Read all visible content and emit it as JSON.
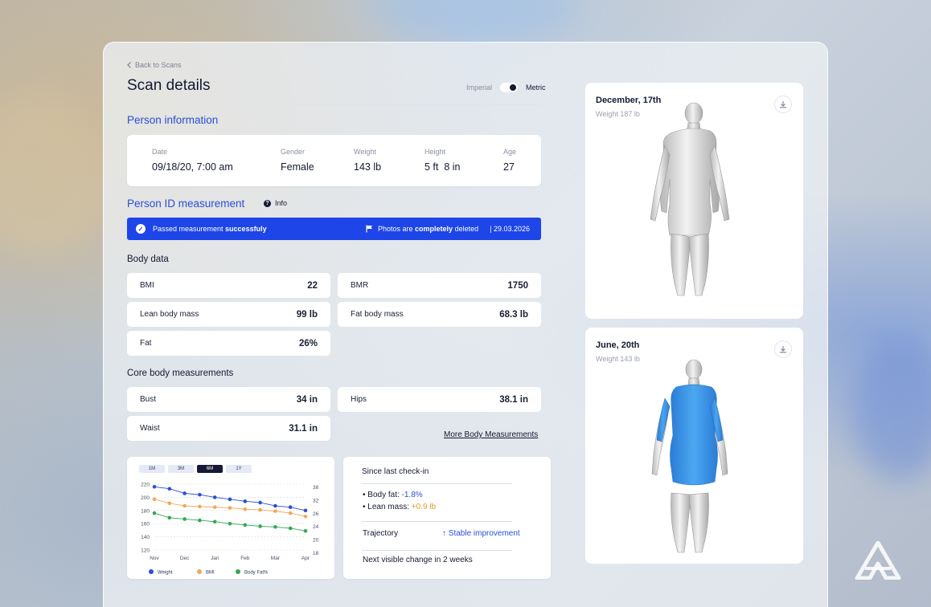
{
  "nav": {
    "back_label": "Back to Scans"
  },
  "page_title": "Scan details",
  "units": {
    "imperial": "Imperial",
    "metric": "Metric",
    "selected": "Metric"
  },
  "person_info": {
    "heading": "Person information",
    "date_label": "Date",
    "date_value": "09/18/20, 7:00 am",
    "gender_label": "Gender",
    "gender_value": "Female",
    "weight_label": "Weight",
    "weight_value": "143 lb",
    "height_label": "Height",
    "height_value": "5 ft  8 in",
    "age_label": "Age",
    "age_value": "27"
  },
  "id_measurement": {
    "heading": "Person ID measurement",
    "info_label": "Info",
    "status_prefix": "Passed measurement ",
    "status_strong": "successfuly",
    "photos_prefix": "Photos are ",
    "photos_strong": "completely",
    "photos_suffix": " deleted",
    "date": "| 29.03.2026"
  },
  "body_data": {
    "heading": "Body data",
    "items": [
      {
        "label": "BMI",
        "value": "22"
      },
      {
        "label": "BMR",
        "value": "1750"
      },
      {
        "label": "Lean body mass",
        "value": "99 lb"
      },
      {
        "label": "Fat body mass",
        "value": "68.3 lb"
      },
      {
        "label": "Fat",
        "value": "26%"
      }
    ]
  },
  "core_measurements": {
    "heading": "Core body measurements",
    "items": [
      {
        "label": "Bust",
        "value": "34 in"
      },
      {
        "label": "Hips",
        "value": "38.1 in"
      },
      {
        "label": "Waist",
        "value": "31.1 in"
      }
    ],
    "more_link": "More Body Measurements"
  },
  "chart": {
    "periods": [
      "1M",
      "3M",
      "6M",
      "1Y"
    ],
    "active_period": "6M"
  },
  "chart_data": {
    "type": "line",
    "x": [
      "Nov",
      "Dec",
      "Jan",
      "Feb",
      "Mar",
      "Apr"
    ],
    "x_points": [
      0,
      0.5,
      1,
      1.5,
      2,
      2.5,
      3,
      3.5,
      4,
      4.5,
      5
    ],
    "left_axis": {
      "ticks": [
        220,
        200,
        180,
        160,
        140,
        120
      ],
      "ylim": [
        120,
        220
      ]
    },
    "right_axis": {
      "ticks": [
        38,
        32,
        26,
        24,
        20,
        18
      ]
    },
    "grid": true,
    "legend_position": "bottom",
    "series": [
      {
        "name": "Weight",
        "color": "#2a4fd6",
        "values": [
          216,
          213,
          206,
          204,
          200,
          197,
          194,
          192,
          187,
          185,
          180
        ]
      },
      {
        "name": "BMI",
        "color": "#f0a95a",
        "values": [
          197,
          191,
          187,
          186,
          185,
          184,
          182,
          181,
          179,
          176,
          171
        ]
      },
      {
        "name": "Body Fat%",
        "color": "#34a853",
        "values": [
          176,
          169,
          167,
          165,
          163,
          160,
          158,
          156,
          155,
          153,
          149
        ]
      }
    ]
  },
  "checkin": {
    "title": "Since last check-in",
    "fat_label": "Body fat: ",
    "fat_value": "-1.8%",
    "lean_label": "Lean mass: ",
    "lean_value": "+0.9 lb",
    "trajectory_label": "Trajectory",
    "trajectory_value": "Stable improvement",
    "next_change": "Next visible change in 2 weeks"
  },
  "scans": [
    {
      "date": "December, 17th",
      "weight": "Weight 187 lb"
    },
    {
      "date": "June, 20th",
      "weight": "Weight 143 lb"
    }
  ],
  "colors": {
    "accent": "#1d45e8",
    "heading_blue": "#2a4fd6",
    "highlight_blue": "#2a8fe8"
  }
}
